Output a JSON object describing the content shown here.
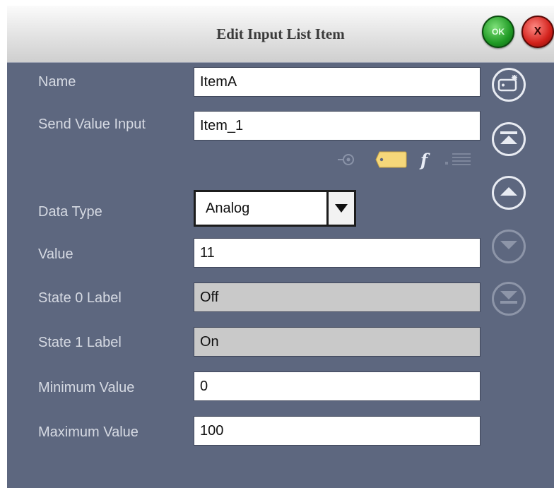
{
  "dialog": {
    "title": "Edit Input List Item",
    "ok_label": "OK",
    "close_label": "X"
  },
  "fields": {
    "name": {
      "label": "Name",
      "value": "ItemA"
    },
    "send_value_input": {
      "label": "Send Value Input",
      "value": "Item_1"
    },
    "data_type": {
      "label": "Data Type",
      "value": "Analog"
    },
    "value": {
      "label": "Value",
      "value": "11"
    },
    "state0": {
      "label": "State 0 Label",
      "value": "Off"
    },
    "state1": {
      "label": "State 1 Label",
      "value": "On"
    },
    "minimum": {
      "label": "Minimum Value",
      "value": "0"
    },
    "maximum": {
      "label": "Maximum Value",
      "value": "100"
    }
  },
  "icons": {
    "connector": "connector-icon",
    "tag": "tag-icon",
    "function": "function-icon",
    "list": "list-icon",
    "add_item": "add-item-icon",
    "move_top": "move-top-icon",
    "move_up": "move-up-icon",
    "move_down": "move-down-icon",
    "move_bottom": "move-bottom-icon",
    "function_glyph": "f"
  },
  "colors": {
    "panel": "#5d677f",
    "label": "#d6dae3",
    "tag": "#f5d77a",
    "function": "#e9edf6",
    "ok": "#1f9a24",
    "close": "#d2211b"
  }
}
